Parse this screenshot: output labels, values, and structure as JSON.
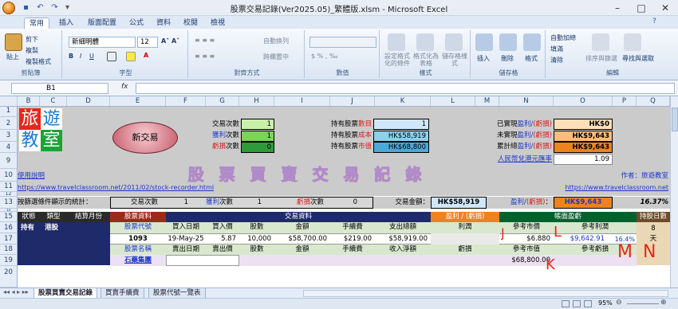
{
  "window": {
    "title": "股票交易記錄(Ver2025.05)_繁體版.xlsm - Microsoft Excel"
  },
  "ribbon": {
    "tabs": [
      "常用",
      "插入",
      "版面配置",
      "公式",
      "資料",
      "校閱",
      "檢視"
    ],
    "clipboard": {
      "paste": "貼上",
      "cut": "剪下",
      "copy": "複製",
      "format_painter": "複製格式",
      "label": "剪貼簿"
    },
    "font": {
      "name": "新細明體",
      "size": "12",
      "label": "字型"
    },
    "alignment": {
      "wrap": "自動換列",
      "merge": "跨欄置中",
      "label": "對齊方式"
    },
    "number": {
      "label": "數值"
    },
    "styles": {
      "conditional": "設定格式化的條件",
      "as_table": "格式化為表格",
      "cell_styles": "儲存格樣式",
      "label": "樣式"
    },
    "cells": {
      "insert": "插入",
      "delete": "刪除",
      "format": "格式",
      "label": "儲存格"
    },
    "editing": {
      "autosum": "自動加總",
      "fill": "填滿",
      "clear": "清除",
      "sort": "排序與篩選",
      "find": "尋找與選取",
      "label": "編輯"
    }
  },
  "formula_bar": {
    "name_box": "B1",
    "fx": "fx",
    "formula": ""
  },
  "columns": [
    "B",
    "C",
    "D",
    "E",
    "F",
    "G",
    "H",
    "I",
    "J",
    "K",
    "L",
    "M",
    "N",
    "O",
    "P",
    "Q"
  ],
  "rows": [
    "1",
    "2",
    "3",
    "4",
    "9",
    "10",
    "11",
    "12",
    "13",
    "14",
    "15",
    "16",
    "17",
    "18",
    "19",
    "20"
  ],
  "sheet": {
    "logo": [
      "旅",
      "遊",
      "教",
      "室"
    ],
    "new_trade": "新交易",
    "counts": {
      "trade_label": "交易次數",
      "trade": "1",
      "win_label": "獲利",
      "win_suffix": "次數",
      "win": "1",
      "loss_label": "虧損",
      "loss_suffix": "次數",
      "loss": "0"
    },
    "holdings": {
      "count_label": "持有股票",
      "count_emph": "數目",
      "count": "1",
      "cost_label": "持有股票",
      "cost_emph": "成本",
      "cost": "HK$58,919",
      "market_label": "持有股票",
      "market_emph": "市值",
      "market": "HK$68,800"
    },
    "pnl": {
      "realized_a": "已實現",
      "realized_b": "盈利/",
      "realized_c": "(虧損)",
      "realized": "HK$0",
      "unrealized_a": "未實現",
      "unrealized_b": "盈利/",
      "unrealized_c": "(虧損)",
      "unrealized": "HK$9,643",
      "total_a": "累計總",
      "total_b": "盈利/",
      "total_c": "(虧損)",
      "total": "HK$9,643",
      "fx_label": "人民幣兌港元匯率",
      "fx": "1.09"
    },
    "banner": "股 票 買 賣 交 易 記 錄",
    "help_link": "使用說明",
    "author_label": "作者：旅遊教室",
    "url_left": "https://www.travelclassroom.net/2011/02/stock-recorder.html",
    "url_right": "https://www.travelclassroom.net",
    "filter_stats": {
      "label": "按篩選條件顯示的統計：",
      "trade_label": "交易次數",
      "trade": "1",
      "win_label": "獲利",
      "win_suffix": "次數",
      "win": "1",
      "loss_label": "虧損",
      "loss_suffix": "次數",
      "loss": "0",
      "amount_label": "交易金額：",
      "amount": "HK$58,919",
      "pnl_label_a": "盈利/",
      "pnl_label_b": "(虧損)",
      "pnl_label_c": "：",
      "pnl": "HK$9,643",
      "pct": "16.37%"
    },
    "header_row": {
      "status": "狀態",
      "type": "類型",
      "settle_month": "結算月份",
      "stock_data": "股票資料",
      "trade_data": "交易資料",
      "pnl": "盈利 / (虧損)",
      "book": "帳面盈虧",
      "days": "持股日數"
    },
    "col_headers_1": [
      "股票代號",
      "買入日期",
      "買入價",
      "股數",
      "金額",
      "手續費",
      "支出總額",
      "利潤",
      "參考市價",
      "參考利潤"
    ],
    "col_headers_2": [
      "股票名稱",
      "賣出日期",
      "賣出價",
      "股數",
      "金額",
      "手續費",
      "收入淨額",
      "虧損",
      "參考市值",
      "參考虧損"
    ],
    "record": {
      "status": "持有",
      "market": "港股",
      "code": "1093",
      "buy_date": "19-May-25",
      "buy_price": "5.87",
      "shares": "10,000",
      "amount": "$58,700.00",
      "fee": "$219.00",
      "total": "$58,919.00",
      "ref_price": "$6.880",
      "ref_profit": "$9,642.91",
      "ref_pct": "16.4%",
      "days": "8",
      "days_unit": "天",
      "name": "石藥集團",
      "ref_value": "$68,800.00"
    },
    "annotations": {
      "j": "J",
      "l": "L",
      "k": "K",
      "m": "M",
      "n": "N"
    }
  },
  "sheet_tabs": [
    "股票買賣交易記錄",
    "買賣手續費",
    "股票代號一覽表"
  ],
  "status": {
    "zoom": "95%"
  },
  "colors": {
    "accent_red": "#e8271a",
    "header_green": "#00612d",
    "header_navy": "#1f2a6b",
    "header_orange": "#f0821e"
  }
}
